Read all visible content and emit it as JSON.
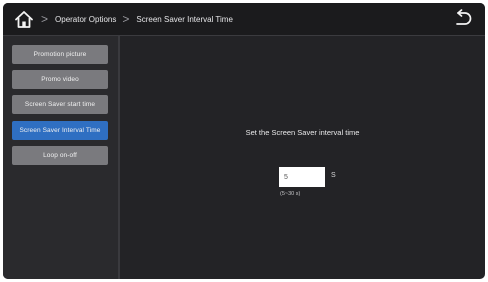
{
  "breadcrumb": {
    "items": [
      "Operator Options",
      "Screen Saver Interval Time"
    ],
    "separator": ">"
  },
  "icons": {
    "home": "home-icon",
    "back": "back-arrow-icon",
    "chevron": "chevron-right-icon"
  },
  "sidebar": {
    "items": [
      {
        "label": "Promotion picture",
        "active": false
      },
      {
        "label": "Promo video",
        "active": false
      },
      {
        "label": "Screen Saver start time",
        "active": false
      },
      {
        "label": "Screen Saver Interval Time",
        "active": true
      },
      {
        "label": "Loop on-off",
        "active": false
      }
    ]
  },
  "main": {
    "heading": "Set the Screen Saver interval time",
    "interval_value": "5",
    "unit": "S",
    "range_hint": "(5~30 s)"
  },
  "colors": {
    "background": "#232326",
    "accent": "#2f6fc2",
    "button": "#7a7a7e"
  }
}
